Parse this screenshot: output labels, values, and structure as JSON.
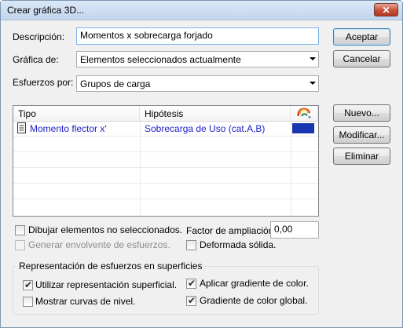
{
  "window": {
    "title": "Crear gráfica 3D...",
    "close_label": "✕"
  },
  "form": {
    "descripcion_label": "Descripción:",
    "descripcion_value": "Momentos x sobrecarga forjado",
    "grafica_label": "Gráfica de:",
    "grafica_value": "Elementos seleccionados actualmente",
    "esfuerzos_label": "Esfuerzos por:",
    "esfuerzos_value": "Grupos de carga"
  },
  "buttons": {
    "aceptar": "Aceptar",
    "cancelar": "Cancelar",
    "nuevo": "Nuevo...",
    "modificar": "Modificar...",
    "eliminar": "Eliminar"
  },
  "table": {
    "columns": [
      "Tipo",
      "Hipótesis",
      "color-palette-icon"
    ],
    "rows": [
      {
        "tipo": "Momento flector x'",
        "hipotesis": "Sobrecarga de Uso (cat.A,B)",
        "color": "#1a35b0"
      }
    ]
  },
  "options": {
    "dibujar": {
      "label": "Dibujar elementos no seleccionados.",
      "checked": false
    },
    "generar": {
      "label": "Generar envolvente de esfuerzos.",
      "checked": false,
      "disabled": true
    },
    "factor_label": "Factor de ampliación",
    "factor_value": "0,00",
    "deformada": {
      "label": "Deformada sólida.",
      "checked": false
    }
  },
  "representacion": {
    "title": "Representación de esfuerzos en superficies",
    "utilizar": {
      "label": "Utilizar representación superficial.",
      "checked": true
    },
    "mostrar": {
      "label": "Mostrar curvas de nivel.",
      "checked": false
    },
    "aplicar": {
      "label": "Aplicar gradiente de color.",
      "checked": true
    },
    "gradiente": {
      "label": "Gradiente de color global.",
      "checked": true
    }
  }
}
